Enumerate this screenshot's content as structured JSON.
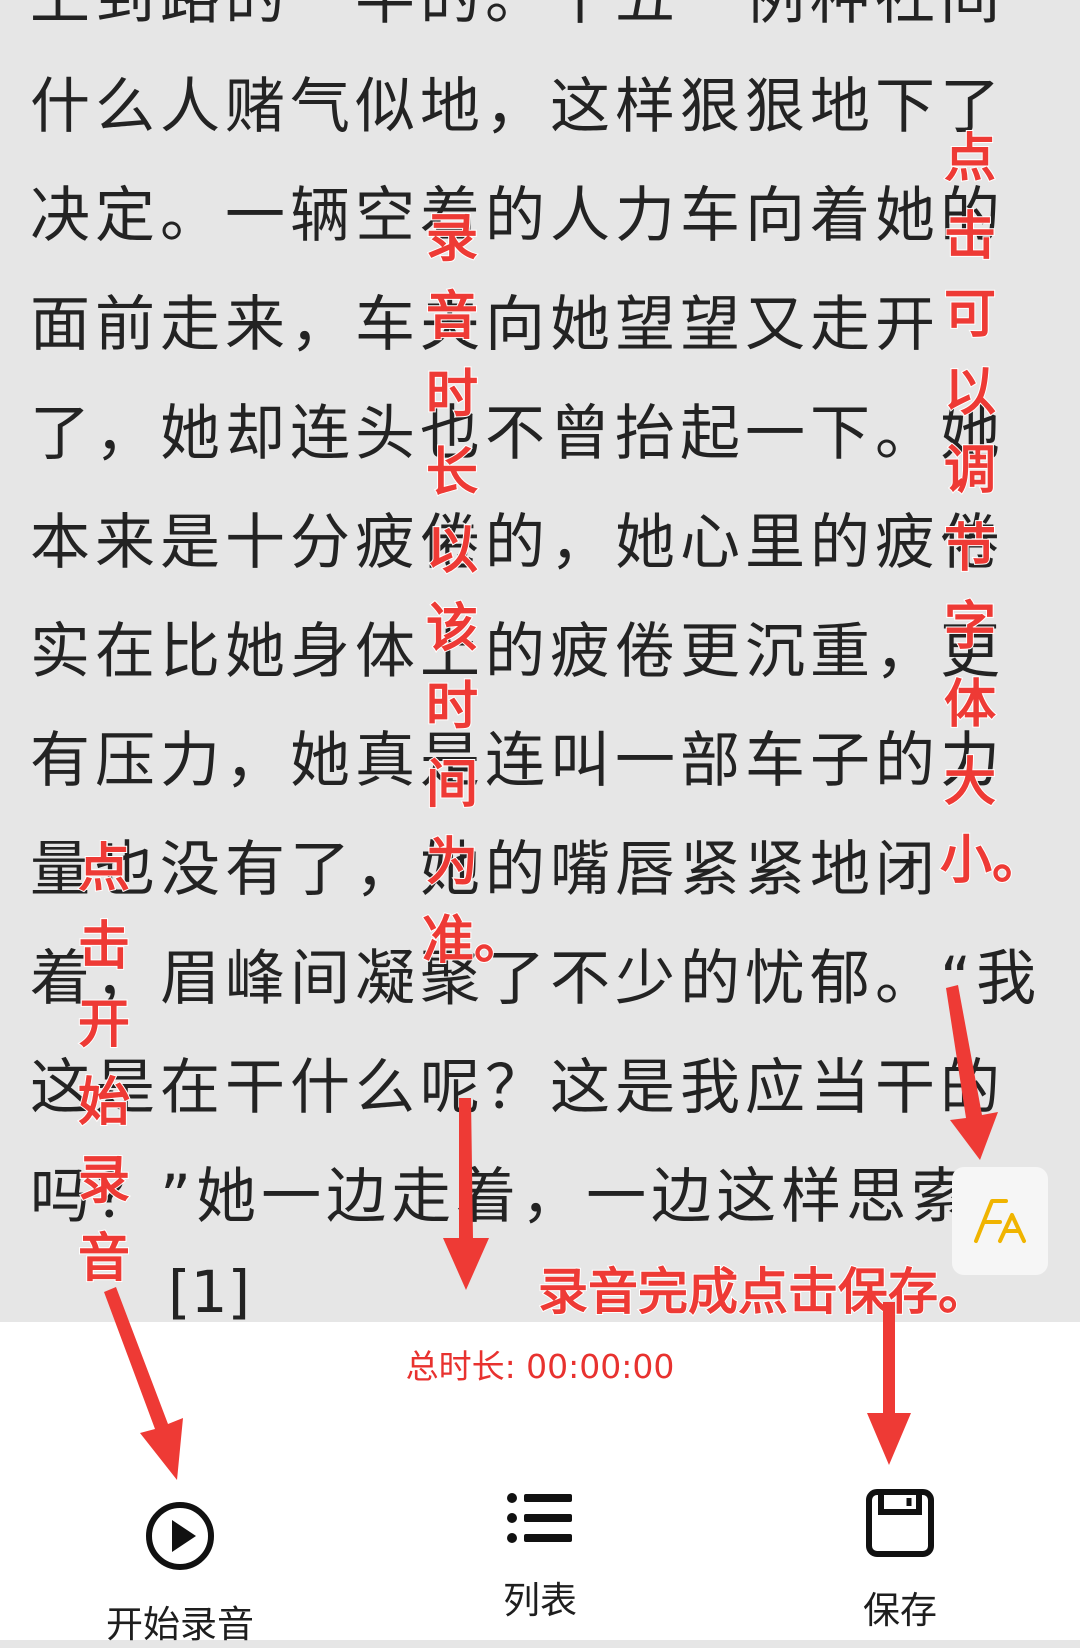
{
  "reader": {
    "lines": [
      "上到路的一半的。十五一例种社间",
      "什么人赌气似地，这样狠狠地下了",
      "决定。一辆空着的人力车向着她的",
      "面前走来，车夫向她望望又走开",
      "了，她却连头也不曾抬起一下。她",
      "本来是十分疲倦的，她心里的疲倦",
      "实在比她身体上的疲倦更沉重，更",
      "有压力，她真是连叫一部车子的力",
      "量也没有了，她的嘴唇紧紧地闭",
      "着，眉峰间凝聚了不少的忧郁。“我",
      "这是在干什么呢？这是我应当干的",
      "吗？”她一边走着，一边这样思索"
    ],
    "footnote": "[1]"
  },
  "recorder": {
    "duration_label": "总时长: 00:00:00",
    "start_label": "开始录音",
    "list_label": "列表",
    "save_label": "保存"
  },
  "annotations": {
    "font_size_tip": "点击可以调节字体大小。",
    "duration_tip": "录音时长以该时间为准。",
    "start_tip": "点击开始录音",
    "save_tip": "录音完成点击保存。"
  },
  "colors": {
    "accent": "#e8322f",
    "annotation": "#ee3a35",
    "reader_bg": "#e6e6e6",
    "font_icon": "#f0b400"
  },
  "icons": {
    "font_size": "font-size-icon",
    "start": "play-circle-icon",
    "list": "list-icon",
    "save": "save-icon"
  }
}
